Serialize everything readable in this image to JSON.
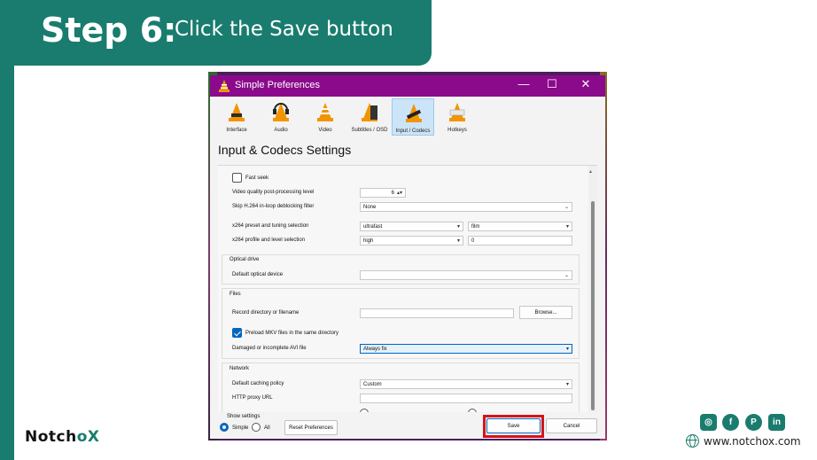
{
  "banner": {
    "step": "Step 6:",
    "instruction": "Click the Save button"
  },
  "window": {
    "title": "Simple Preferences",
    "controls": {
      "minimize": "—",
      "maximize": "☐",
      "close": "✕"
    },
    "tabs": [
      {
        "label": "Interface"
      },
      {
        "label": "Audio"
      },
      {
        "label": "Video"
      },
      {
        "label": "Subtitles / OSD"
      },
      {
        "label": "Input / Codecs"
      },
      {
        "label": "Hotkeys"
      }
    ],
    "active_tab": "Input / Codecs",
    "heading": "Input & Codecs Settings",
    "settings": {
      "fast_seek": "Fast seek",
      "vq_label": "Video quality post-processing level",
      "vq_value": "6",
      "skip_label": "Skip H.264 in-loop deblocking filter",
      "skip_value": "None",
      "x264_preset_label": "x264 preset and tuning selection",
      "x264_preset_value": "ultrafast",
      "x264_tune_value": "film",
      "x264_profile_label": "x264 profile and level selection",
      "x264_profile_value": "high",
      "x264_level_value": "0",
      "optical_group": "Optical drive",
      "optical_label": "Default optical device",
      "optical_value": "",
      "files_group": "Files",
      "record_label": "Record directory or filename",
      "record_value": "",
      "browse": "Browse...",
      "preload_label": "Preload MKV files in the same directory",
      "avi_label": "Damaged or incomplete AVI file",
      "avi_value": "Always fix",
      "network_group": "Network",
      "caching_label": "Default caching policy",
      "caching_value": "Custom",
      "proxy_label": "HTTP proxy URL"
    },
    "footer": {
      "show_settings": "Show settings",
      "simple": "Simple",
      "all": "All",
      "reset": "Reset Preferences",
      "save": "Save",
      "cancel": "Cancel"
    }
  },
  "brand": {
    "logo_a": "Notch",
    "logo_b": "oX",
    "website": "www.notchox.com",
    "social": [
      "instagram-icon",
      "facebook-icon",
      "pinterest-icon",
      "linkedin-icon"
    ],
    "accent": "#197c6e",
    "highlight": "#d6141b"
  }
}
